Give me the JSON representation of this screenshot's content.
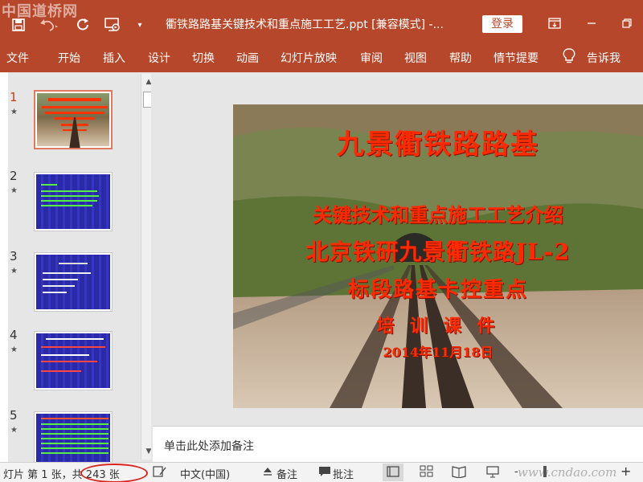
{
  "watermark_top": "中国道桥网",
  "watermark_bottom": "www.cndao.com",
  "titlebar": {
    "title": "衢铁路路基关键技术和重点施工工艺.ppt [兼容模式]  -...",
    "login_label": "登录",
    "qat_icons": [
      "save-icon",
      "undo-icon",
      "redo-icon",
      "present-icon",
      "customize-icon"
    ],
    "window_icons": [
      "ribbon-options-icon",
      "minimize-icon",
      "restore-icon"
    ]
  },
  "ribbon": {
    "tabs": [
      "文件",
      "开始",
      "插入",
      "设计",
      "切换",
      "动画",
      "幻灯片放映",
      "审阅",
      "视图",
      "帮助",
      "情节提要"
    ],
    "tell_me": "告诉我"
  },
  "thumbnails": [
    {
      "number": "1",
      "star": "★",
      "active": true
    },
    {
      "number": "2",
      "star": "★",
      "active": false
    },
    {
      "number": "3",
      "star": "★",
      "active": false
    },
    {
      "number": "4",
      "star": "★",
      "active": false
    },
    {
      "number": "5",
      "star": "★",
      "active": false
    }
  ],
  "slide": {
    "title_line1": "九景衢铁路路基",
    "title_line2": "关键技术和重点施工工艺介绍",
    "title_line3": "北京铁研九景衢铁路JL-2",
    "title_line4": "标段路基卡控重点",
    "subtitle": "培 训 课 件",
    "date": "2014年11月18日"
  },
  "notes": {
    "placeholder": "单击此处添加备注"
  },
  "statusbar": {
    "slide_info": "灯片 第 1 张，共 243 张",
    "language": "中文(中国)",
    "notes_label": "备注",
    "comments_label": "批注",
    "zoom_minus": "-",
    "zoom_plus": "+"
  },
  "colors": {
    "accent": "#b7472a",
    "title_red": "#ff2a00",
    "highlight_circle": "#d9251d"
  }
}
